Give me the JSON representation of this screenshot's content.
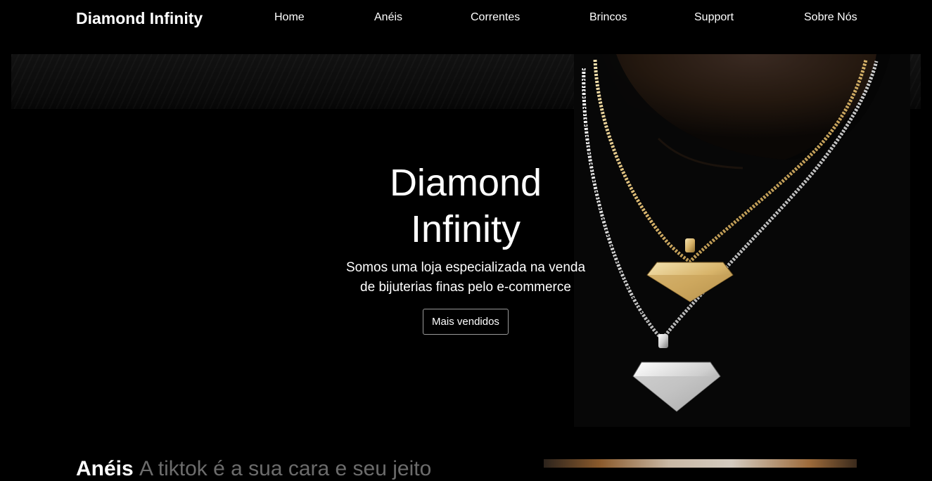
{
  "navbar": {
    "brand": "Diamond Infinity",
    "links": [
      "Home",
      "Anéis",
      "Correntes",
      "Brincos",
      "Support",
      "Sobre Nós"
    ]
  },
  "hero": {
    "title_line1": "Diamond",
    "title_line2": "Infinity",
    "subtitle_line1": "Somos uma loja especializada na venda",
    "subtitle_line2": "de bijuterias finas pelo e-commerce",
    "button_label": "Mais vendidos",
    "image": "necklace-photo"
  },
  "featured": {
    "heading_main": "Anéis",
    "heading_muted": "A tiktok é a sua cara e seu jeito"
  },
  "colors": {
    "background": "#000000",
    "text": "#ffffff",
    "gold": "#d8b46a",
    "silver": "#e6e6e6"
  }
}
